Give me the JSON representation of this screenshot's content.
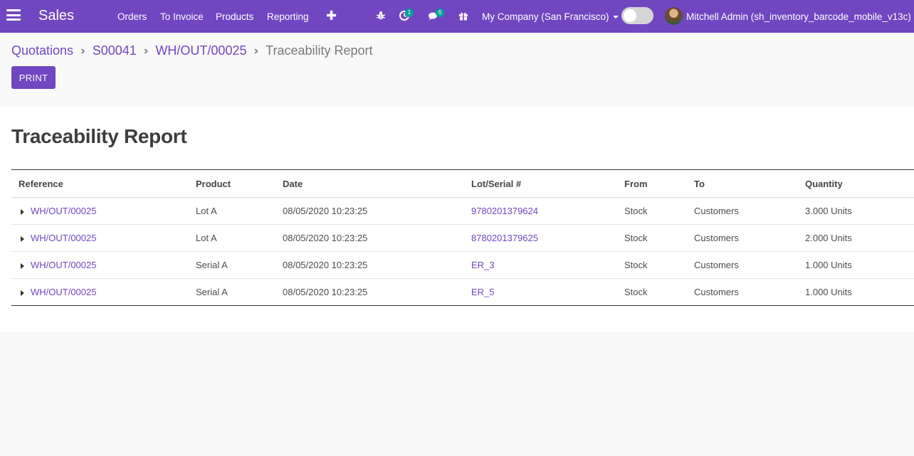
{
  "navbar": {
    "app_name": "Sales",
    "menu": [
      "Orders",
      "To Invoice",
      "Products",
      "Reporting"
    ],
    "activity_badge": "1",
    "messages_badge": "6",
    "company": "My Company (San Francisco)",
    "user": "Mitchell Admin (sh_inventory_barcode_mobile_v13c)",
    "icons": [
      "menu-icon",
      "plus-icon",
      "debug-icon",
      "activity-icon",
      "chat-icon",
      "gift-icon"
    ],
    "colors": {
      "primary": "#7146c1",
      "badge": "#00a09d"
    }
  },
  "breadcrumb": {
    "items": [
      "Quotations",
      "S00041",
      "WH/OUT/00025"
    ],
    "current": "Traceability Report"
  },
  "buttons": {
    "print": "PRINT"
  },
  "report": {
    "title": "Traceability Report",
    "columns": [
      "Reference",
      "Product",
      "Date",
      "Lot/Serial #",
      "From",
      "To",
      "Quantity"
    ],
    "rows": [
      {
        "reference": "WH/OUT/00025",
        "product": "Lot A",
        "date": "08/05/2020 10:23:25",
        "lot": "9780201379624",
        "from": "Stock",
        "to": "Customers",
        "quantity": "3.000 Units"
      },
      {
        "reference": "WH/OUT/00025",
        "product": "Lot A",
        "date": "08/05/2020 10:23:25",
        "lot": "8780201379625",
        "from": "Stock",
        "to": "Customers",
        "quantity": "2.000 Units"
      },
      {
        "reference": "WH/OUT/00025",
        "product": "Serial A",
        "date": "08/05/2020 10:23:25",
        "lot": "ER_3",
        "from": "Stock",
        "to": "Customers",
        "quantity": "1.000 Units"
      },
      {
        "reference": "WH/OUT/00025",
        "product": "Serial A",
        "date": "08/05/2020 10:23:25",
        "lot": "ER_5",
        "from": "Stock",
        "to": "Customers",
        "quantity": "1.000 Units"
      }
    ]
  }
}
